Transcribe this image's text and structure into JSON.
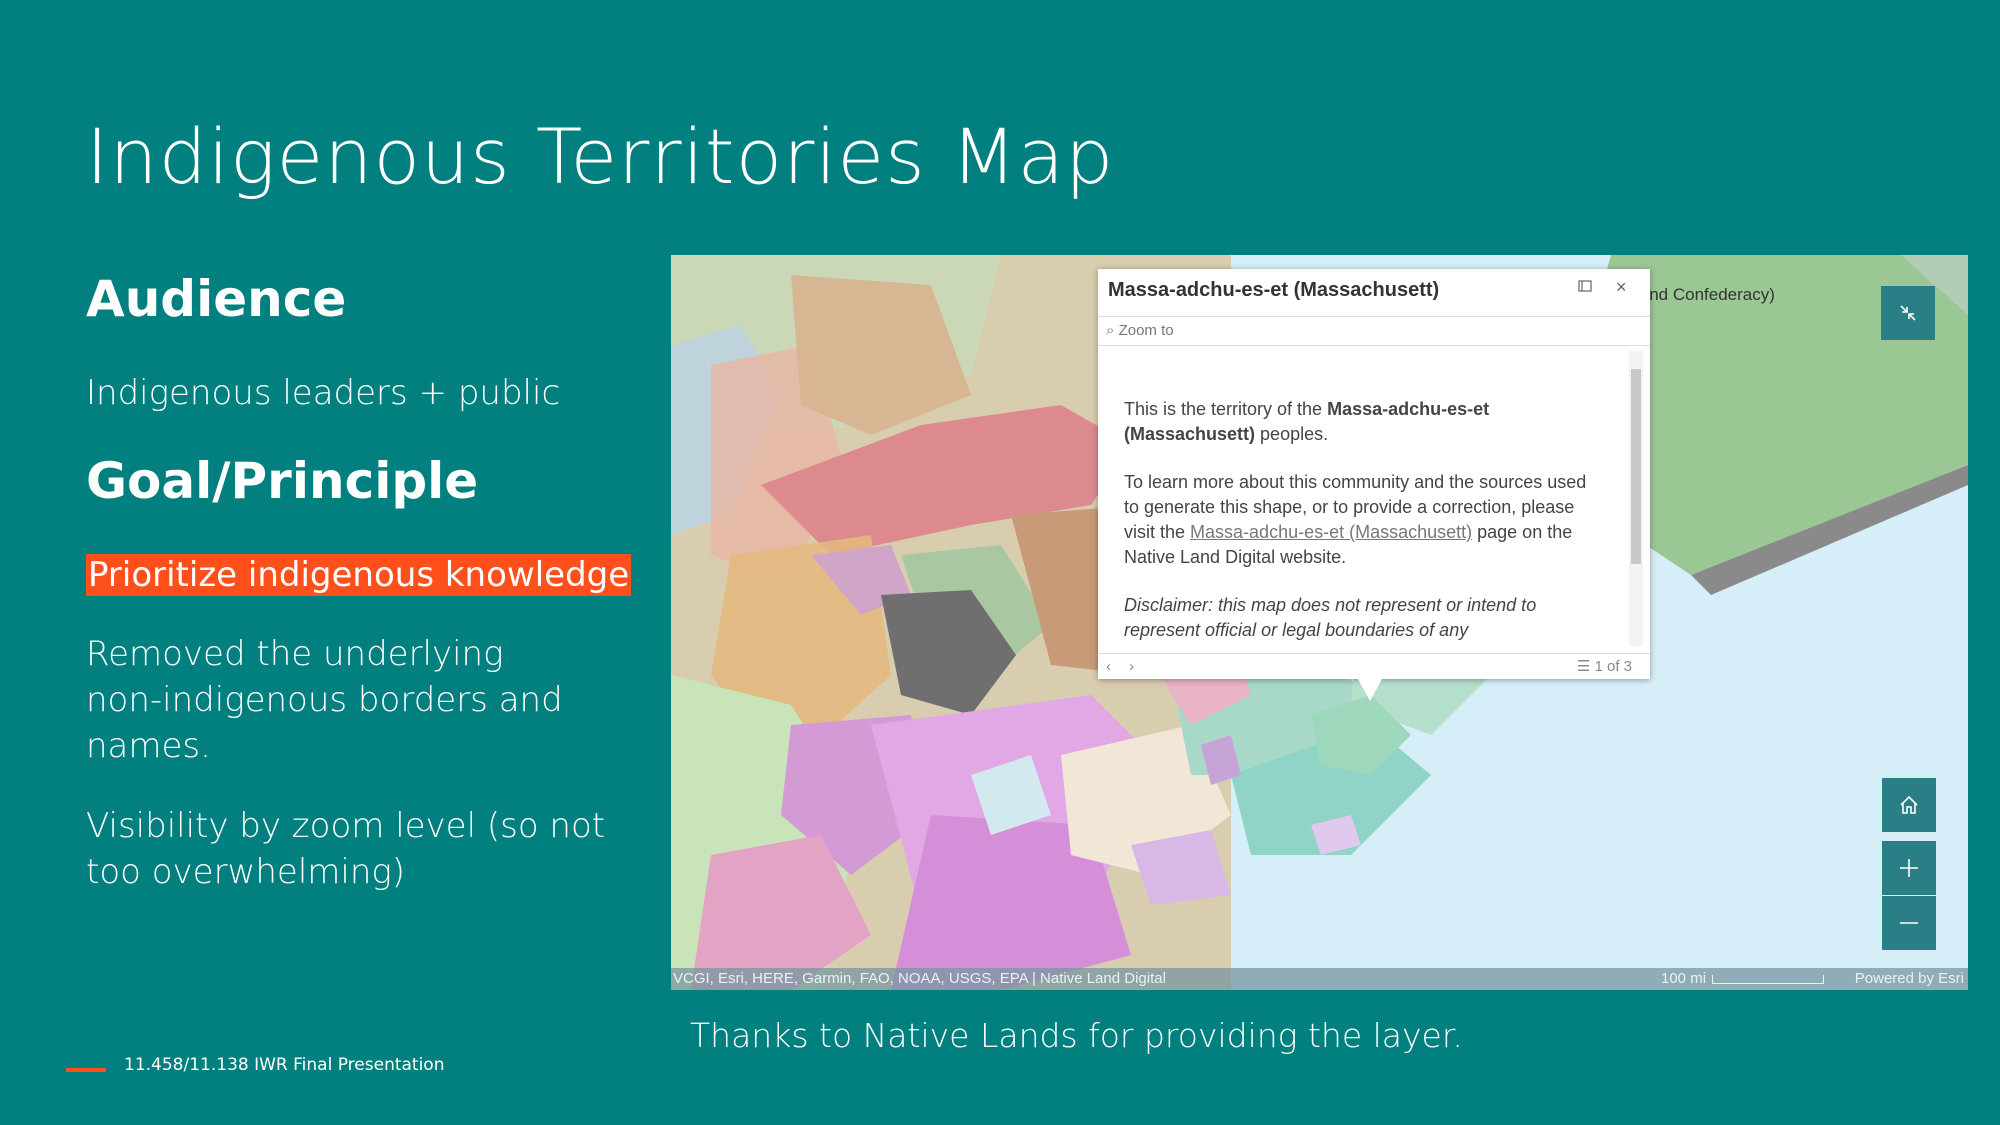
{
  "slide": {
    "title": "Indigenous Territories Map",
    "audience_heading": "Audience",
    "audience_text": "Indigenous leaders + public",
    "goal_heading": "Goal/Principle",
    "highlight": "Prioritize indigenous knowledge",
    "point1_line1": "Removed the underlying",
    "point1_line2": "non-indigenous borders and",
    "point1_line3": "names.",
    "point2_line1": "Visibility by zoom level (so not",
    "point2_line2": "too overwhelming)",
    "caption": "Thanks to Native Lands for providing the layer.",
    "footer": "11.458/11.138 IWR Final Presentation",
    "accent_color": "#ff4f1a",
    "background_color": "#027f7f"
  },
  "map": {
    "territory_label": "land Confederacy)",
    "attribution": "VCGI, Esri, HERE, Garmin, FAO, NOAA, USGS, EPA | Native Land Digital",
    "scale": "100 mi",
    "powered_by": "Powered by Esri",
    "controls": {
      "collapse_icon": "collapse-icon",
      "home_icon": "home-icon",
      "zoom_in_icon": "plus-icon",
      "zoom_out_icon": "minus-icon"
    },
    "popup": {
      "title": "Massa-adchu-es-et (Massachusett)",
      "zoom_to": "Zoom to",
      "p1_a": "This is the territory of the ",
      "p1_bold": "Massa-adchu-es-et (Massachusett)",
      "p1_b": " peoples.",
      "p2_a": "To learn more about this community and the sources used to generate this shape, or to provide a correction, please visit the ",
      "p2_link": "Massa-adchu-es-et (Massachusett)",
      "p2_b": " page on the Native Land Digital website.",
      "disclaimer": "Disclaimer: this map does not represent or intend to",
      "disclaimer_cut": "represent official or legal boundaries of any",
      "pager": "1 of 3",
      "prev": "‹",
      "next": "›"
    }
  }
}
